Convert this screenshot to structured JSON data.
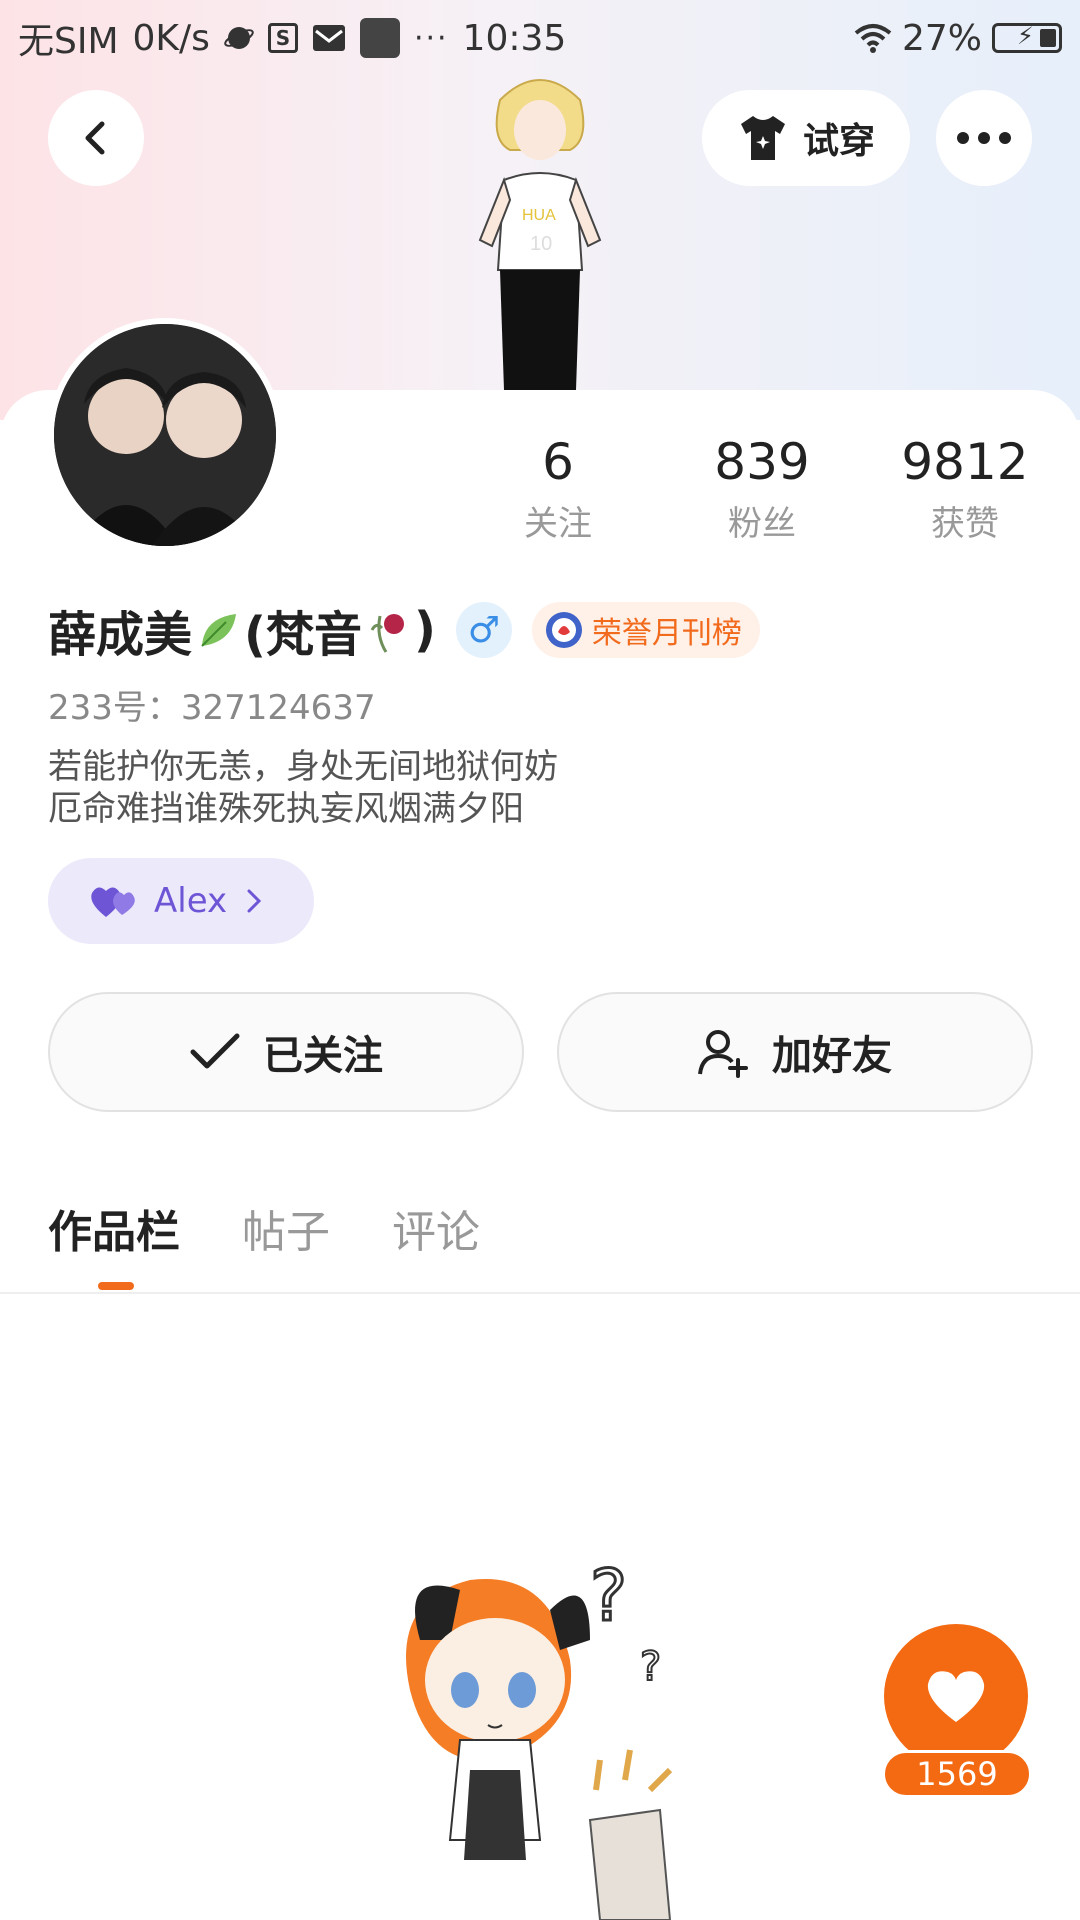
{
  "status_bar": {
    "carrier": "无SIM",
    "speed": "0K/s",
    "time": "10:35",
    "battery": "27%"
  },
  "header": {
    "try_on_label": "试穿"
  },
  "profile": {
    "stats": [
      {
        "value": "6",
        "label": "关注"
      },
      {
        "value": "839",
        "label": "粉丝"
      },
      {
        "value": "9812",
        "label": "获赞"
      }
    ],
    "name": "薛成美",
    "name_suffix_open": "(梵音",
    "name_suffix_close": ")",
    "gender_symbol": "♂",
    "honor_badge": "荣誉月刊榜",
    "uid": "233号：327124637",
    "bio_line1": "若能护你无恙，身处无间地狱何妨",
    "bio_line2": "厄命难挡谁殊死执妄风烟满夕阳",
    "cp_name": "Alex"
  },
  "actions": {
    "follow_label": "已关注",
    "add_friend_label": "加好友"
  },
  "tabs": [
    {
      "label": "作品栏",
      "active": true
    },
    {
      "label": "帖子",
      "active": false
    },
    {
      "label": "评论",
      "active": false
    }
  ],
  "like": {
    "count": "1569"
  },
  "colors": {
    "accent": "#f46a12",
    "cp_purple": "#6e55d6",
    "gender_blue": "#3b8ee6"
  }
}
